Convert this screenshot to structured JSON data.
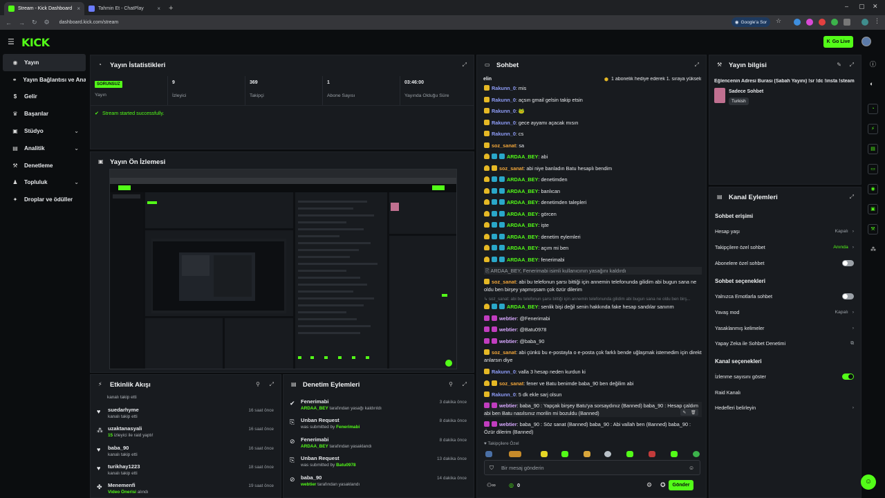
{
  "browser": {
    "tabs": [
      {
        "label": "Stream - Kick Dashboard",
        "active": true
      },
      {
        "label": "Tahmin Et - ChatPlay",
        "active": false
      }
    ],
    "url": "dashboard.kick.com/stream",
    "google_button": "Google'a Sor"
  },
  "app": {
    "logo": "KICK",
    "go_live": "Go Live",
    "colors": {
      "accent": "#53fc18",
      "panel": "#181b1f",
      "bg": "#0b0d0f"
    }
  },
  "sidebar": {
    "items": [
      {
        "label": "Yayın",
        "icon": "broadcast-icon",
        "active": true
      },
      {
        "label": "Yayın Bağlantısı ve Anahtarı",
        "icon": "link-icon"
      },
      {
        "label": "Gelir",
        "icon": "dollar-icon"
      },
      {
        "label": "Başarılar",
        "icon": "trophy-icon"
      },
      {
        "label": "Stüdyo",
        "icon": "studio-icon",
        "chevron": "⌄"
      },
      {
        "label": "Analitik",
        "icon": "chart-icon",
        "chevron": "⌄"
      },
      {
        "label": "Denetleme",
        "icon": "wrench-icon"
      },
      {
        "label": "Topluluk",
        "icon": "community-icon",
        "chevron": "⌄"
      },
      {
        "label": "Droplar ve ödüller",
        "icon": "gift-icon"
      }
    ]
  },
  "stats": {
    "title": "Yayın İstatistikleri",
    "status_badge": "SORUNSUZ",
    "status_label": "Yayın",
    "viewers": "9",
    "viewers_label": "İzleyici",
    "followers": "369",
    "followers_label": "Takipçi",
    "subs": "1",
    "subs_label": "Abone Sayısı",
    "uptime": "03:46:00",
    "uptime_label": "Yayında Olduğu Süre",
    "message": "Stream started successfully."
  },
  "preview": {
    "title": "Yayın Ön İzlemesi"
  },
  "activity": {
    "title": "Etkinlik Akışı",
    "top_partial": "kanalı takip etti",
    "rows": [
      {
        "name": "suedarhyme",
        "sub": "kanalı takip etti",
        "time": "16 saat önce",
        "icon": "heart-icon"
      },
      {
        "name": "uzaktanasyali",
        "sub_num": "15",
        "sub": " izleyici ile raid yaptı!",
        "time": "16 saat önce",
        "icon": "raid-icon"
      },
      {
        "name": "baba_90",
        "sub": "kanalı takip etti",
        "time": "16 saat önce",
        "icon": "heart-icon"
      },
      {
        "name": "turikhay1223",
        "sub": "kanalı takip etti",
        "time": "18 saat önce",
        "icon": "heart-icon"
      },
      {
        "name": "Menemenfi",
        "sub_g": "Video Önerisi",
        "sub": " alındı",
        "time": "19 saat önce",
        "icon": "video-icon"
      }
    ]
  },
  "moderation": {
    "title": "Denetim Eylemleri",
    "rows": [
      {
        "name": "Fenerimabi",
        "who": "ARDAA_BEY",
        "sub": " tarafından yasağı kaldırıldı",
        "time": "3 dakika önce",
        "icon": "check-circle-icon"
      },
      {
        "name": "Unban Request",
        "pre": "was submitted by ",
        "who": "Fenerimabi",
        "time": "8 dakika önce",
        "icon": "doc-icon"
      },
      {
        "name": "Fenerimabi",
        "who": "ARDAA_BEY",
        "sub": " tarafından yasaklandı",
        "time": "8 dakika önce",
        "icon": "ban-icon"
      },
      {
        "name": "Unban Request",
        "pre": "was submitted by ",
        "who": "Batu0978",
        "time": "13 dakika önce",
        "icon": "doc-icon"
      },
      {
        "name": "baba_90",
        "who": "webtier",
        "sub": " tarafından yasaklandı",
        "time": "14 dakika önce",
        "icon": "ban-icon"
      }
    ]
  },
  "chat": {
    "title": "Sohbet",
    "pinned_user": "elin",
    "pinned_text": "1 abonelik hediye ederek 1. sıraya yükseldi",
    "messages": [
      {
        "user": "Rakunn_0",
        "color": "blue",
        "badges": [
          "y"
        ],
        "text": ": mis"
      },
      {
        "user": "Rakunn_0",
        "color": "blue",
        "badges": [
          "y"
        ],
        "text": ": açsın gmail gelsin takip etsin"
      },
      {
        "user": "Rakunn_0",
        "color": "blue",
        "badges": [
          "y"
        ],
        "text": ": 🐸"
      },
      {
        "user": "Rakunn_0",
        "color": "blue",
        "badges": [
          "y"
        ],
        "text": ": gece ayyamı açacak mısın"
      },
      {
        "user": "Rakunn_0",
        "color": "blue",
        "badges": [
          "y"
        ],
        "text": ": cs"
      },
      {
        "user": "soz_sanat",
        "color": "or",
        "badges": [
          "y"
        ],
        "text": ": sa"
      },
      {
        "user": "ARDAA_BEY",
        "color": "gr",
        "badges": [
          "c",
          "b",
          "b"
        ],
        "text": ": abi"
      },
      {
        "user": "soz_sanat",
        "color": "or",
        "badges": [
          "c",
          "y"
        ],
        "text": ": abi niye banladın Batu hesaplı bendim"
      },
      {
        "user": "ARDAA_BEY",
        "color": "gr",
        "badges": [
          "c",
          "b",
          "b"
        ],
        "text": ": denetimden"
      },
      {
        "user": "ARDAA_BEY",
        "color": "gr",
        "badges": [
          "c",
          "b",
          "b"
        ],
        "text": ": banlıcan"
      },
      {
        "user": "ARDAA_BEY",
        "color": "gr",
        "badges": [
          "c",
          "b",
          "b"
        ],
        "text": ": denetimden talepleri"
      },
      {
        "user": "ARDAA_BEY",
        "color": "gr",
        "badges": [
          "c",
          "b",
          "b"
        ],
        "text": ": görcen"
      },
      {
        "user": "ARDAA_BEY",
        "color": "gr",
        "badges": [
          "c",
          "b",
          "b"
        ],
        "text": ": işte"
      },
      {
        "user": "ARDAA_BEY",
        "color": "gr",
        "badges": [
          "c",
          "b",
          "b"
        ],
        "text": ": denetim eylemleri"
      },
      {
        "user": "ARDAA_BEY",
        "color": "gr",
        "badges": [
          "c",
          "b",
          "b"
        ],
        "text": ": açım mi ben"
      },
      {
        "user": "ARDAA_BEY",
        "color": "gr",
        "badges": [
          "c",
          "b",
          "b"
        ],
        "text": ": fenerimabi"
      }
    ],
    "system_line": "ARDAA_BEY, Fenerimabi isimli kullanıcının yasağını kaldırdı",
    "long_msg_user": "soz_sanat",
    "long_msg_text": ": abi bu telefonun şarsı bittiği için annemin telefonunda gilidim abi bugun sana ne oldu ben birşey yapmışsam çok özür dilerim",
    "reply_preview": "↳ soz_sanat: abi bu telefonun şarsı bittiği için annemin telefonunda gilidim abi bugun sana ne oldu ben birş...",
    "messages2": [
      {
        "user": "ARDAA_BEY",
        "color": "gr",
        "badges": [
          "c",
          "b",
          "b"
        ],
        "text": ": senlik bişi değil senin hakkında fake hesap sandılar sanırım"
      },
      {
        "user": "webtier",
        "color": "pk",
        "badges": [
          "p",
          "p"
        ],
        "text": ": @Fenerimabi"
      },
      {
        "user": "webtier",
        "color": "pk",
        "badges": [
          "p",
          "p"
        ],
        "text": ": @Batu0978"
      },
      {
        "user": "webtier",
        "color": "pk",
        "badges": [
          "p",
          "p"
        ],
        "text": ": @baba_90"
      }
    ],
    "msg_sanat2": ": abi çünkü bu e-postayla o e-posta çok farklı bende uğlaşmak istemedim için direkt anlarsın diye",
    "messages3": [
      {
        "user": "Rakunn_0",
        "color": "blue",
        "badges": [
          "y"
        ],
        "text": ": valla 3 hesap neden kurdun ki"
      },
      {
        "user": "soz_sanat",
        "color": "or",
        "badges": [
          "c",
          "y"
        ],
        "text": ": fener ve Batu benimde baba_90 ben değilim abi"
      },
      {
        "user": "Rakunn_0",
        "color": "blue",
        "badges": [
          "y"
        ],
        "text": ": 5 dk ekle sarj olsun"
      }
    ],
    "web_msg1": ": baba_90 : Yapçak birşey Batu'ya sorsaydınız (Banned) baba_90 : Hesap çaldım abi ben Batu nasılsınız morilin mi bozuldu (Banned)",
    "web_msg2": ": baba_90 : Söz sanat (Banned) baba_90 : Abi vallah ben (Banned) baba_90 : Özür dilerim (Banned)",
    "followers_only": "Takipçilere Özel",
    "input_placeholder": "Bir mesaj gönderin",
    "count": "0",
    "send": "Gönder"
  },
  "stream_info": {
    "title": "Yayın bilgisi",
    "stream_title": "Eğlencenin Adresi Burası (Sabah Yayını) !sr !dc !insta !steam",
    "category": "Sadece Sohbet",
    "tag": "Turkish"
  },
  "channel_actions": {
    "title": "Kanal Eylemleri",
    "chat_access": "Sohbet erişimi",
    "account_age": "Hesap yaşı",
    "account_age_val": "Kapalı",
    "followers_chat": "Takipçilere özel sohbet",
    "followers_chat_val": "Anında",
    "subs_chat": "Abonelere özel sohbet",
    "chat_options": "Sohbet seçenekleri",
    "emote_only": "Yalnızca Emotlarla sohbet",
    "slow_mode": "Yavaş mod",
    "slow_mode_val": "Kapalı",
    "banned_words": "Yasaklanmış kelimeler",
    "ai_moderation": "Yapay Zeka ile Sohbet Denetimi",
    "channel_options": "Kanal seçenekleri",
    "show_viewers": "İzlenme sayısını göster",
    "raid": "Raid Kanalı",
    "targets": "Hedefleri belirleyin"
  }
}
